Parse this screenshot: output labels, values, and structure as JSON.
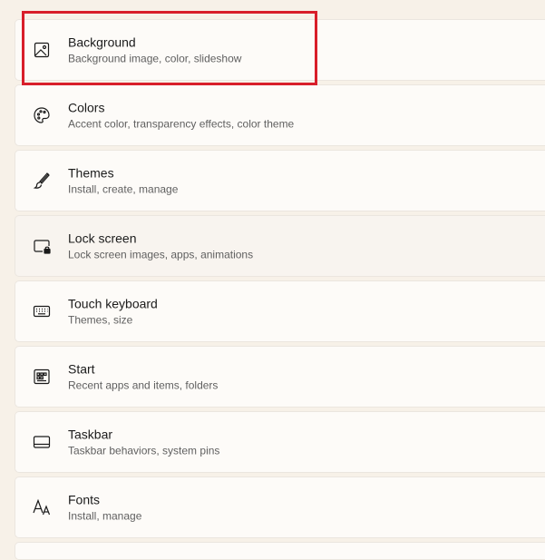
{
  "items": [
    {
      "title": "Background",
      "subtitle": "Background image, color, slideshow",
      "icon": "image-icon"
    },
    {
      "title": "Colors",
      "subtitle": "Accent color, transparency effects, color theme",
      "icon": "palette-icon"
    },
    {
      "title": "Themes",
      "subtitle": "Install, create, manage",
      "icon": "brush-icon"
    },
    {
      "title": "Lock screen",
      "subtitle": "Lock screen images, apps, animations",
      "icon": "lock-screen-icon"
    },
    {
      "title": "Touch keyboard",
      "subtitle": "Themes, size",
      "icon": "keyboard-icon"
    },
    {
      "title": "Start",
      "subtitle": "Recent apps and items, folders",
      "icon": "start-icon"
    },
    {
      "title": "Taskbar",
      "subtitle": "Taskbar behaviors, system pins",
      "icon": "taskbar-icon"
    },
    {
      "title": "Fonts",
      "subtitle": "Install, manage",
      "icon": "fonts-icon"
    }
  ],
  "colors": {
    "highlight": "#d81e2a",
    "card_bg": "#fdfbf8",
    "page_bg": "#f7f1e8"
  }
}
